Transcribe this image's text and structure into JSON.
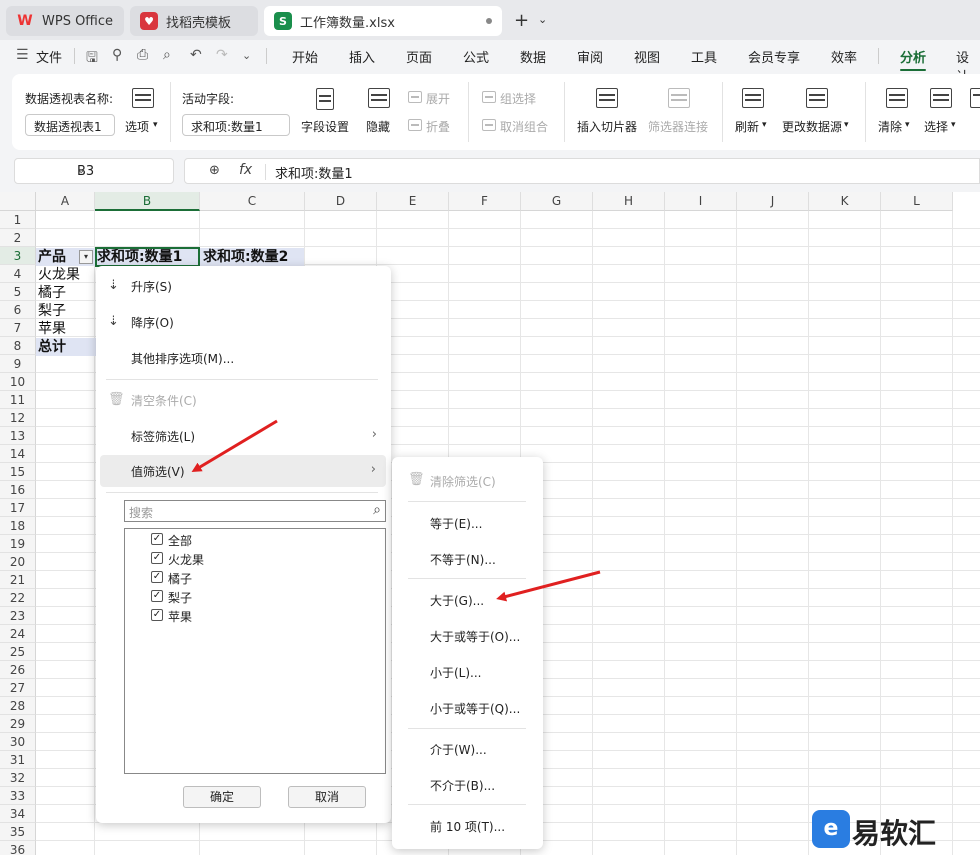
{
  "tabs": [
    {
      "label": "WPS Office",
      "icon": "wps-logo-icon"
    },
    {
      "label": "找稻壳模板",
      "icon": "docer-logo-icon"
    },
    {
      "label": "工作簿数量.xlsx",
      "icon": "spreadsheet-file-icon"
    }
  ],
  "tab_icons": {
    "wps": "W",
    "docer": "♥",
    "sheet": "S"
  },
  "tab_actions": {
    "new": "+",
    "more": "⌄"
  },
  "menu_bar": {
    "file": "文件",
    "items": [
      "开始",
      "插入",
      "页面",
      "公式",
      "数据",
      "审阅",
      "视图",
      "工具",
      "会员专享",
      "效率",
      "分析",
      "设计"
    ],
    "active": "分析"
  },
  "ribbon": {
    "pivot_name_label": "数据透视表名称:",
    "pivot_name_value": "数据透视表1",
    "options": "选项",
    "active_field_label": "活动字段:",
    "active_field_value": "求和项:数量1",
    "field_settings": "字段设置",
    "hide": "隐藏",
    "expand": "展开",
    "collapse": "折叠",
    "group_selection": "组选择",
    "ungroup": "取消组合",
    "insert_slicer": "插入切片器",
    "filter_connections": "筛选器连接",
    "refresh": "刷新",
    "change_source": "更改数据源",
    "clear": "清除",
    "select": "选择"
  },
  "formula_bar": {
    "cell_ref": "B3",
    "zoom_icon": "⊕",
    "fx_label": "fx",
    "formula": "求和项:数量1"
  },
  "columns": [
    "A",
    "B",
    "C",
    "D",
    "E",
    "F",
    "G",
    "H",
    "I",
    "J",
    "K",
    "L"
  ],
  "rows": [
    "1",
    "2",
    "3",
    "4",
    "5",
    "6",
    "7",
    "8",
    "9",
    "10",
    "11",
    "12",
    "13",
    "14",
    "15",
    "16",
    "17",
    "18",
    "19",
    "20",
    "21",
    "22",
    "23",
    "24",
    "25",
    "26",
    "27",
    "28",
    "29",
    "30",
    "31",
    "32",
    "33",
    "34",
    "35",
    "36"
  ],
  "selected_column": "B",
  "selected_row": "3",
  "pivot": {
    "header_product": "产品",
    "header_sum1": "求和项:数量1",
    "header_sum2": "求和项:数量2",
    "items": [
      "火龙果",
      "橘子",
      "梨子",
      "苹果"
    ],
    "total": "总计"
  },
  "dropdown_menu": {
    "sort_asc": "升序(S)",
    "sort_desc": "降序(O)",
    "more_sort": "其他排序选项(M)...",
    "clear_condition": "清空条件(C)",
    "label_filter": "标签筛选(L)",
    "value_filter": "值筛选(V)",
    "search_placeholder": "搜索",
    "list": [
      "全部",
      "火龙果",
      "橘子",
      "梨子",
      "苹果"
    ],
    "ok": "确定",
    "cancel": "取消"
  },
  "submenu": {
    "clear_filter": "清除筛选(C)",
    "items": [
      "等于(E)...",
      "不等于(N)...",
      "大于(G)...",
      "大于或等于(O)...",
      "小于(L)...",
      "小于或等于(Q)...",
      "介于(W)...",
      "不介于(B)...",
      "前 10 项(T)..."
    ]
  },
  "watermark": {
    "logo": "e",
    "text": "易软汇"
  },
  "colors": {
    "accent": "#1b6e37",
    "arrow": "#e02020",
    "pivot_fill": "#dfe4f3"
  }
}
